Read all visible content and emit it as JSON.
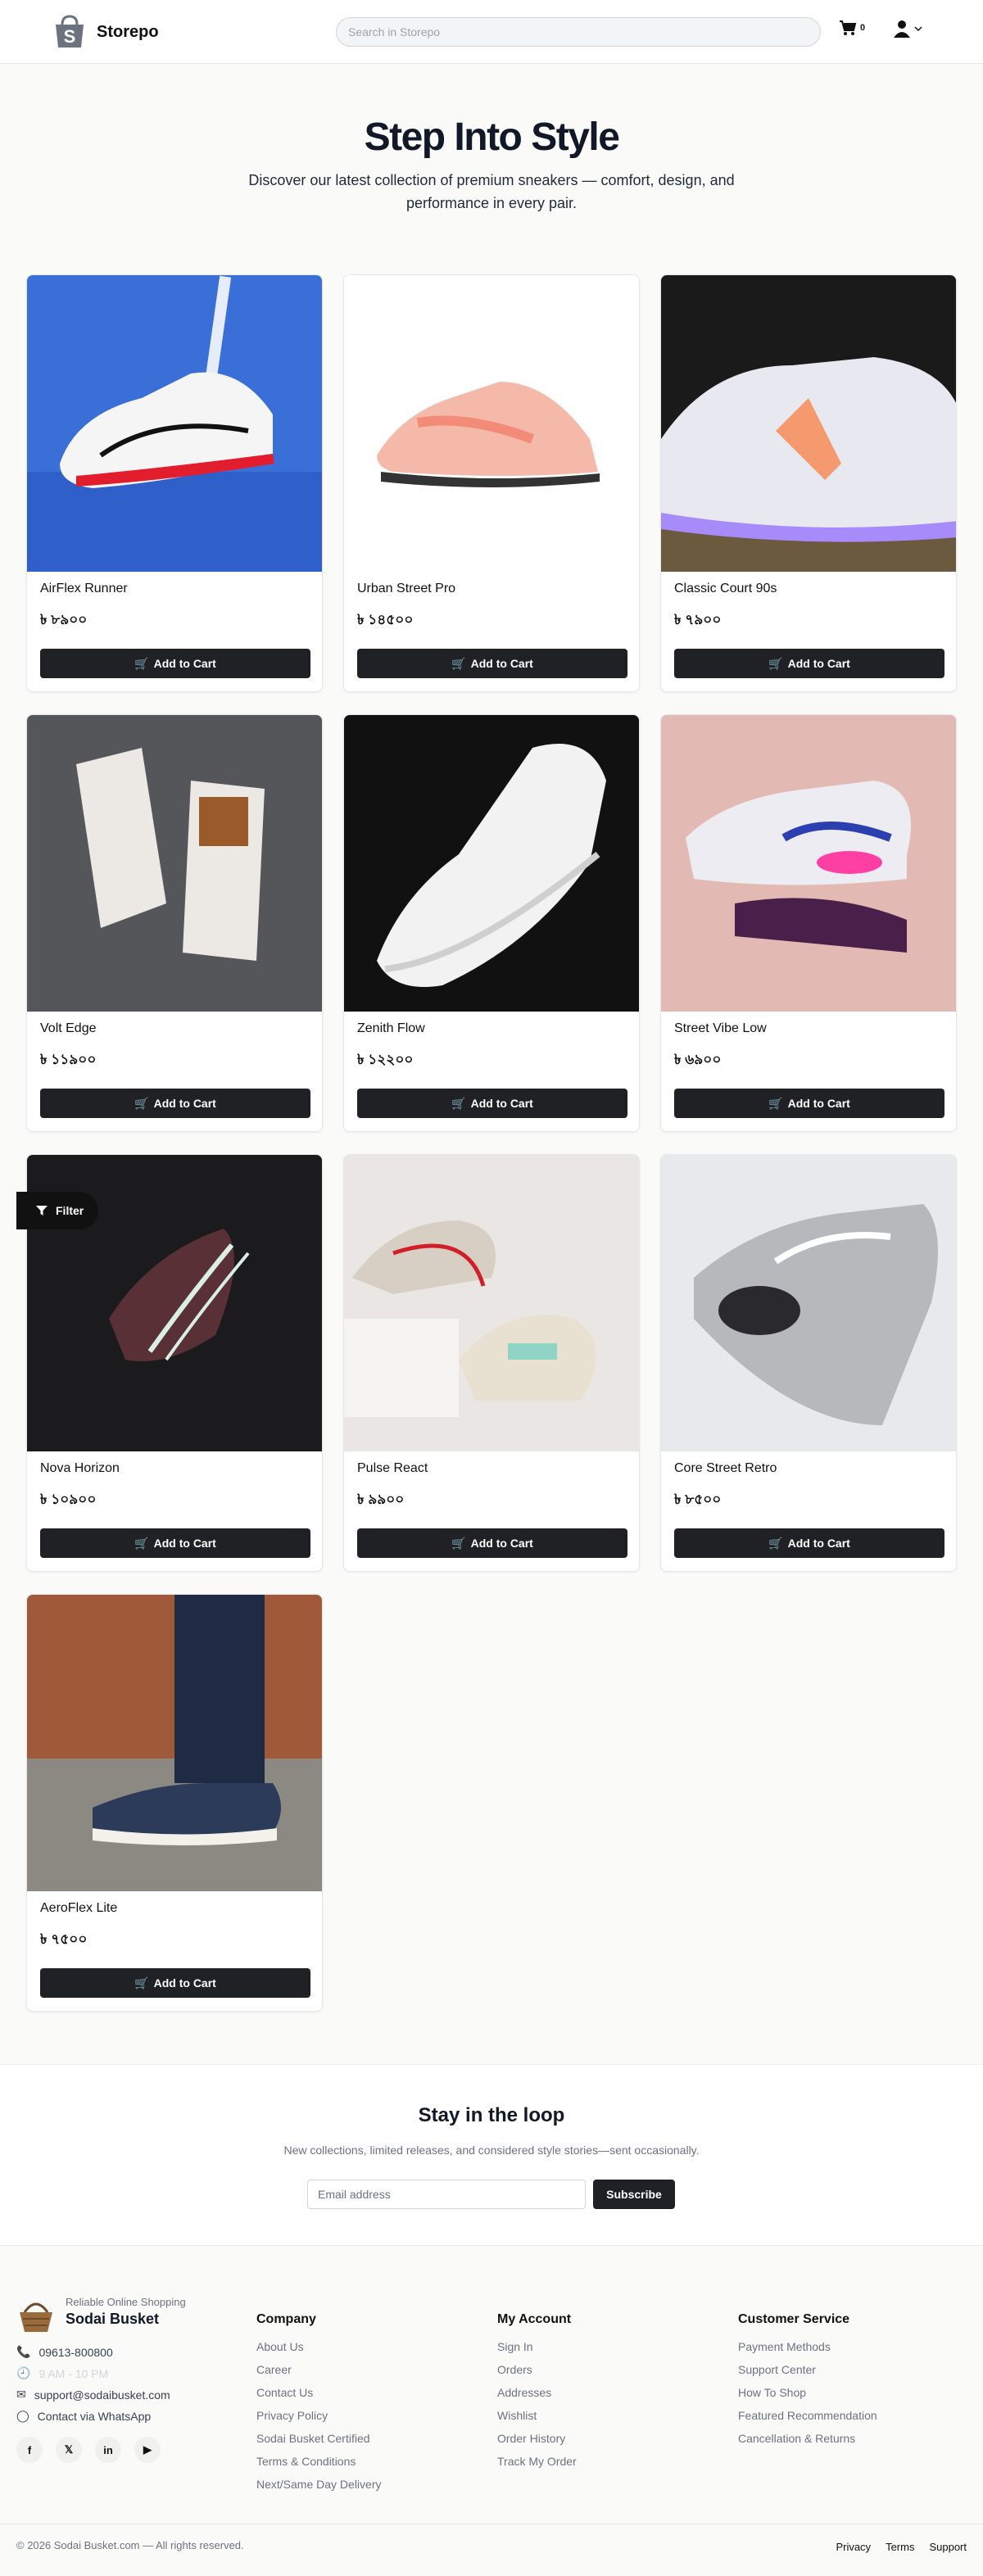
{
  "header": {
    "brand": "Storepo",
    "search_placeholder": "Search in Storepo",
    "cart_count": "0"
  },
  "hero": {
    "title": "Step Into Style",
    "subtitle": "Discover our latest collection of premium sneakers — comfort, design, and performance in every pair."
  },
  "filter_label": "Filter",
  "add_to_cart_label": "Add to Cart",
  "products": [
    {
      "name": "AirFlex Runner",
      "price": "৳ ৮৯০০"
    },
    {
      "name": "Urban Street Pro",
      "price": "৳ ১৪৫০০"
    },
    {
      "name": "Classic Court 90s",
      "price": "৳ ৭৯০০"
    },
    {
      "name": "Volt Edge",
      "price": "৳ ১১৯০০"
    },
    {
      "name": "Zenith Flow",
      "price": "৳ ১২২০০"
    },
    {
      "name": "Street Vibe Low",
      "price": "৳ ৬৯০০"
    },
    {
      "name": "Nova Horizon",
      "price": "৳ ১০৯০০"
    },
    {
      "name": "Pulse React",
      "price": "৳ ৯৯০০"
    },
    {
      "name": "Core Street Retro",
      "price": "৳ ৮৫০০"
    },
    {
      "name": "AeroFlex Lite",
      "price": "৳ ৭৫০০"
    }
  ],
  "newsletter": {
    "title": "Stay in the loop",
    "subtitle": "New collections, limited releases, and considered style stories—sent occasionally.",
    "placeholder": "Email address",
    "button": "Subscribe"
  },
  "footer": {
    "tagline": "Reliable Online Shopping",
    "brand": "Sodai Busket",
    "phone": "09613-800800",
    "hours": "9 AM - 10 PM",
    "email": "support@sodaibusket.com",
    "whatsapp": "Contact via WhatsApp",
    "columns": [
      {
        "title": "Company",
        "links": [
          "About Us",
          "Career",
          "Contact Us",
          "Privacy Policy",
          "Sodai Busket Certified",
          "Terms & Conditions",
          "Next/Same Day Delivery"
        ]
      },
      {
        "title": "My Account",
        "links": [
          "Sign In",
          "Orders",
          "Addresses",
          "Wishlist",
          "Order History",
          "Track My Order"
        ]
      },
      {
        "title": "Customer Service",
        "links": [
          "Payment Methods",
          "Support Center",
          "How To Shop",
          "Featured Recommendation",
          "Cancellation & Returns"
        ]
      }
    ],
    "copyright": "© 2026 Sodai Busket.com — All rights reserved.",
    "legal": [
      "Privacy",
      "Terms",
      "Support"
    ]
  }
}
